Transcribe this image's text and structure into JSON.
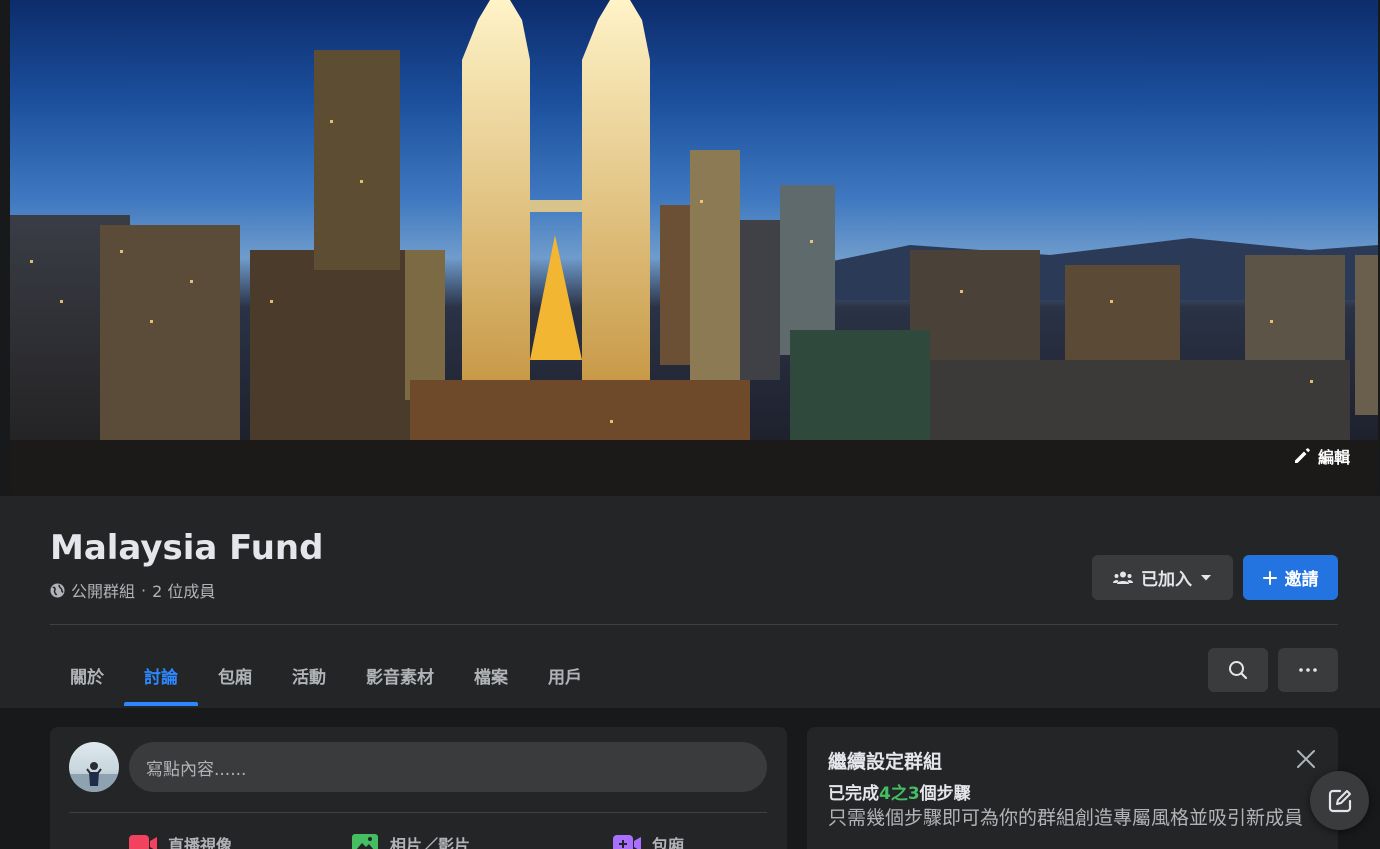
{
  "cover": {
    "edit_label": "編輯"
  },
  "group": {
    "name": "Malaysia Fund",
    "privacy": "公開群組",
    "separator": "·",
    "members": "2 位成員"
  },
  "actions": {
    "joined_label": "已加入",
    "invite_label": "邀請"
  },
  "tabs": [
    {
      "label": "關於"
    },
    {
      "label": "討論",
      "active": true
    },
    {
      "label": "包廂"
    },
    {
      "label": "活動"
    },
    {
      "label": "影音素材"
    },
    {
      "label": "檔案"
    },
    {
      "label": "用戶"
    }
  ],
  "composer": {
    "placeholder": "寫點內容......",
    "actions": [
      {
        "label": "直播視像",
        "icon": "live-video-icon",
        "color": "#f3425f"
      },
      {
        "label": "相片／影片",
        "icon": "photo-video-icon",
        "color": "#45bd62"
      },
      {
        "label": "包廂",
        "icon": "room-icon",
        "color": "#a970ff"
      }
    ]
  },
  "setup": {
    "title": "繼續設定群組",
    "progress_prefix": "已完成",
    "progress_count": "4之3",
    "progress_suffix": "個步驟",
    "description": "只需幾個步驟即可為你的群組創造專屬風格並吸引新成員"
  },
  "colors": {
    "accent": "#2d88ff",
    "invite_bg": "#2374e1",
    "progress_green": "#45bd62"
  }
}
